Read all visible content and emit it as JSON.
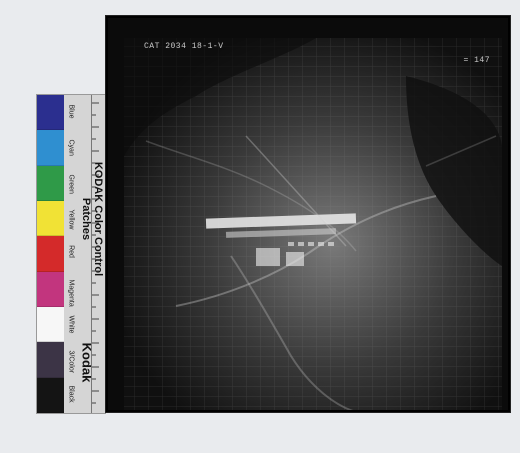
{
  "photo_annotations": {
    "top_left": "CAT 2034 18-1-V",
    "top_right": "= 147"
  },
  "kodak_strip": {
    "brand_line": "KODAK Color Control Patches",
    "brand_mark": "Kodak",
    "patches": [
      {
        "name": "Blue",
        "color": "#2b2f8f"
      },
      {
        "name": "Cyan",
        "color": "#2f8fd0"
      },
      {
        "name": "Green",
        "color": "#2f9a48"
      },
      {
        "name": "Yellow",
        "color": "#f1e235"
      },
      {
        "name": "Red",
        "color": "#d42a2a"
      },
      {
        "name": "Magenta",
        "color": "#c2357e"
      },
      {
        "name": "White",
        "color": "#f7f7f7"
      },
      {
        "name": "3/Color",
        "color": "#3c3446"
      },
      {
        "name": "Black",
        "color": "#141414"
      }
    ]
  }
}
